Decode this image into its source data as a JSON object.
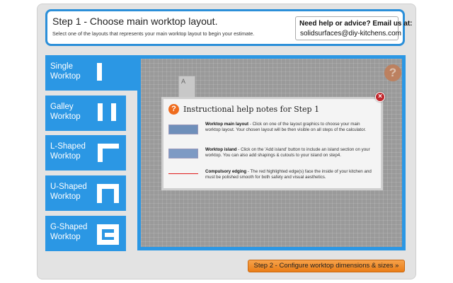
{
  "header": {
    "title": "Step 1 - Choose main worktop layout.",
    "subtitle": "Select one of the layouts that represents your main worktop layout to begin your estimate.",
    "help_title": "Need help or advice? Email us at:",
    "help_email": "solidsurfaces@diy-kitchens.com"
  },
  "sidebar": {
    "items": [
      {
        "label": "Single\nWorktop",
        "icon": "single-worktop-icon"
      },
      {
        "label": "Galley\nWorktop",
        "icon": "galley-worktop-icon"
      },
      {
        "label": "L-Shaped\nWorktop",
        "icon": "l-shaped-worktop-icon"
      },
      {
        "label": "U-Shaped\nWorktop",
        "icon": "u-shaped-worktop-icon"
      },
      {
        "label": "G-Shaped\nWorktop",
        "icon": "g-shaped-worktop-icon"
      }
    ]
  },
  "canvas": {
    "block_label": "A",
    "help_icon": "?"
  },
  "modal": {
    "title": "Instructional help notes for Step 1",
    "close_icon": "×",
    "notes": [
      {
        "heading": "Worktop main layout",
        "text": " - Click on one of the layout graphics to choose your main worktop layout. Your chosen layout will be then visible on all steps of the calculator."
      },
      {
        "heading": "Worktop island",
        "text": " - Click on the 'Add island' button to include an island section on your worktop. You can also add shapings & cutouts to your island on step4."
      },
      {
        "heading": "Compulsory edging",
        "text": " - The red highlighted edge(s) face the inside of your kitchen and must be polished smooth for both safety and visual aesthetics."
      }
    ]
  },
  "footer": {
    "next_label": "Step 2 - Configure worktop dimensions & sizes »"
  },
  "colors": {
    "accent_blue": "#2b97e4",
    "next_orange": "#ea7d17",
    "close_red": "#c0272d"
  }
}
